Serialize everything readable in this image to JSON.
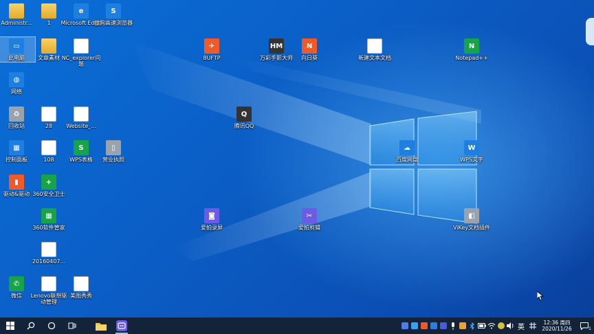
{
  "desktop_icons": [
    {
      "label": "Administr...",
      "kind": "user"
    },
    {
      "label": "1",
      "kind": "folder"
    },
    {
      "label": "Microsoft Edge",
      "kind": "edge"
    },
    {
      "label": "搜狗高速浏览器",
      "kind": "sogou"
    },
    {
      "label": "此电脑",
      "kind": "pc"
    },
    {
      "label": "文章素材",
      "kind": "folder"
    },
    {
      "label": "NC_explorer问题",
      "kind": "doc"
    },
    {
      "label": "网络",
      "kind": "network"
    },
    {
      "label": "回收站",
      "kind": "recycle"
    },
    {
      "label": "28",
      "kind": "doc28"
    },
    {
      "label": "Website_...",
      "kind": "docw"
    },
    {
      "label": "控制面板",
      "kind": "control"
    },
    {
      "label": "108",
      "kind": "doc108"
    },
    {
      "label": "WPS表格",
      "kind": "wpsx"
    },
    {
      "label": "营业执照",
      "kind": "phone"
    },
    {
      "label": "驱动&驱动",
      "kind": "book"
    },
    {
      "label": "360安全卫士",
      "kind": "s360"
    },
    {
      "label": "360软件管家",
      "kind": "s360b"
    },
    {
      "label": "20160407...",
      "kind": "img"
    },
    {
      "label": "微信",
      "kind": "wechat"
    },
    {
      "label": "Lenovo联想驱动管理",
      "kind": "doc"
    },
    {
      "label": "美图秀秀",
      "kind": "doc"
    },
    {
      "label": "8UFTP",
      "kind": "ftp"
    },
    {
      "label": "万彩手影大师",
      "kind": "hm"
    },
    {
      "label": "向日葵",
      "kind": "sun"
    },
    {
      "label": "新建文本文档",
      "kind": "txt"
    },
    {
      "label": "Notepad++",
      "kind": "npp"
    },
    {
      "label": "腾讯QQ",
      "kind": "qq"
    },
    {
      "label": "百度网盘",
      "kind": "baidu"
    },
    {
      "label": "WPS文字",
      "kind": "wpsw"
    },
    {
      "label": "爱拍录屏",
      "kind": "rec"
    },
    {
      "label": "爱拍剪辑",
      "kind": "cut"
    },
    {
      "label": "ViKey文档插件",
      "kind": "vikey"
    }
  ],
  "taskbar": {
    "start": "⊞",
    "search": "⚲",
    "cortana": "○",
    "taskview": "⧉",
    "apps": [
      "file-explorer",
      "screen-recorder"
    ],
    "ime": "英",
    "time": "12:36 周四",
    "date": "2020/11/26",
    "notification_count": "1"
  },
  "colors": {
    "desktop": "#0b5fc7",
    "taskbar": "#13233a",
    "logo_glow": "#5ec2ff"
  }
}
